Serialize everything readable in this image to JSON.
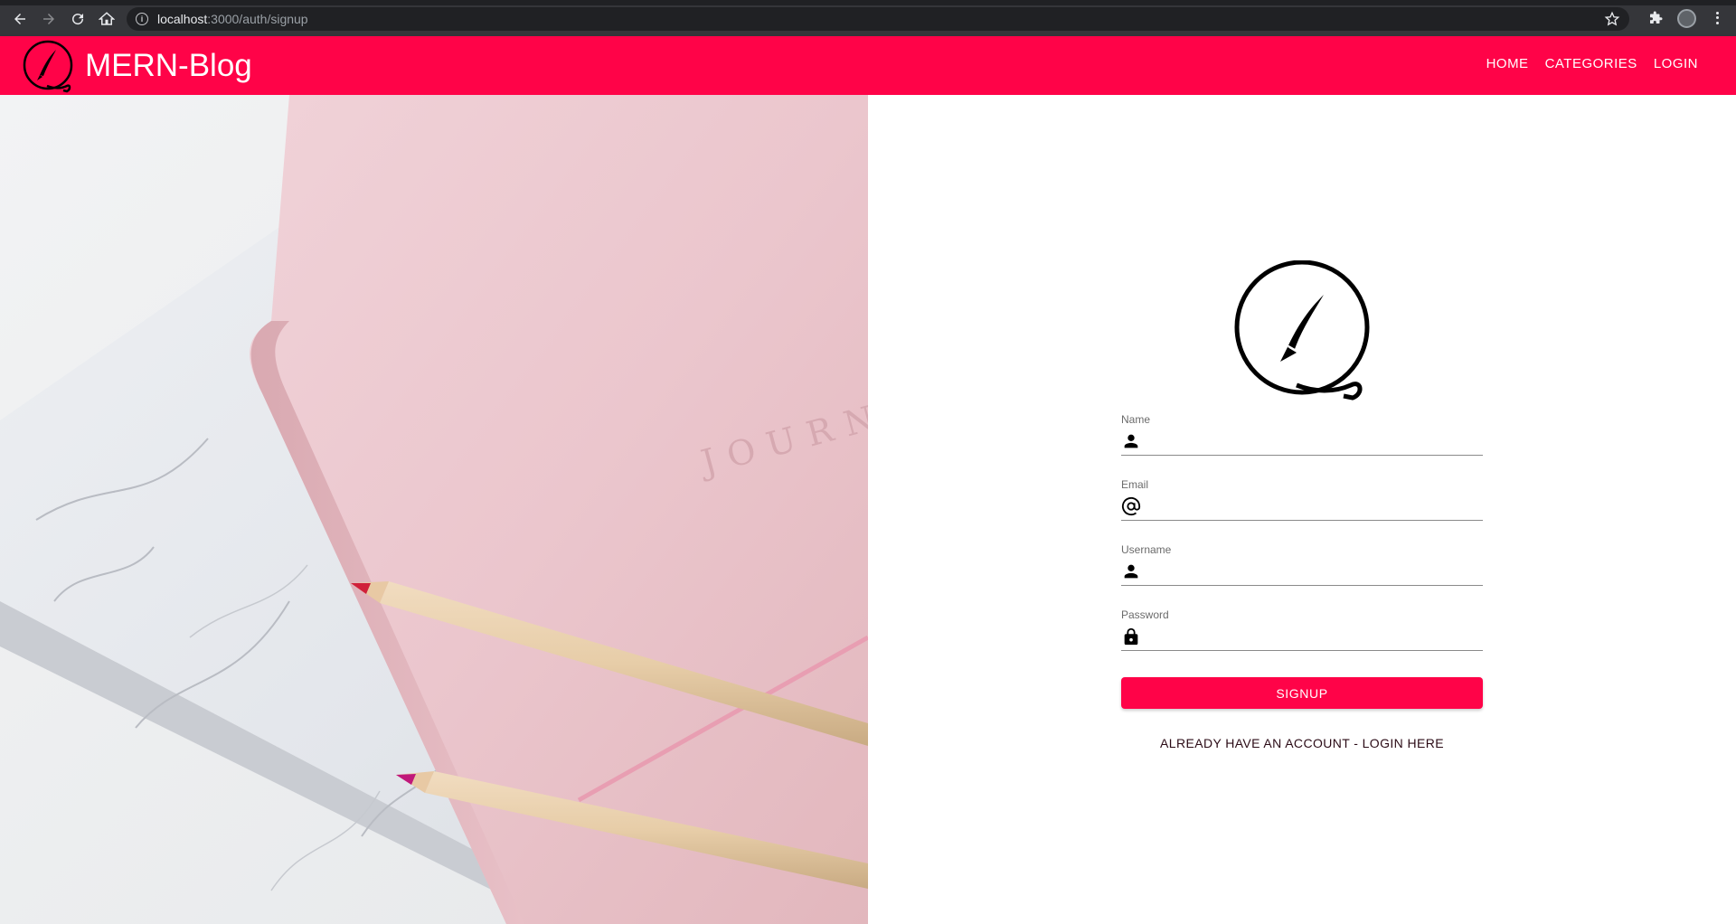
{
  "browser": {
    "url_host": "localhost",
    "url_path": ":3000/auth/signup"
  },
  "app": {
    "title": "MERN-Blog",
    "accent_color": "#ff0348",
    "nav": [
      {
        "label": "HOME"
      },
      {
        "label": "CATEGORIES"
      },
      {
        "label": "LOGIN"
      }
    ]
  },
  "hero": {
    "journal_text": "JOURN",
    "image_subject": "pink journal and marble notebook with two colored pencils"
  },
  "form": {
    "fields": [
      {
        "label": "Name",
        "icon": "person-icon",
        "value": ""
      },
      {
        "label": "Email",
        "icon": "at-sign-icon",
        "value": ""
      },
      {
        "label": "Username",
        "icon": "person-icon",
        "value": ""
      },
      {
        "label": "Password",
        "icon": "lock-icon",
        "value": ""
      }
    ],
    "submit_label": "SIGNUP",
    "login_link": "ALREADY HAVE AN ACCOUNT - LOGIN HERE"
  }
}
